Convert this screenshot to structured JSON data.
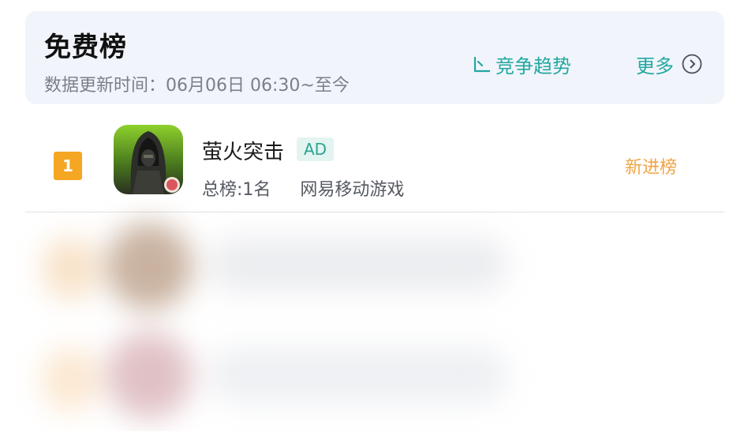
{
  "header": {
    "title": "免费榜",
    "update_time": "数据更新时间：06月06日 06:30~至今",
    "trend_label": "竞争趋势",
    "more_label": "更多"
  },
  "list": [
    {
      "rank": "1",
      "name": "萤火突击",
      "ad_tag": "AD",
      "overall_rank": "总榜:1名",
      "publisher": "网易移动游戏",
      "status": "新进榜"
    }
  ],
  "icons": {
    "trend": "trend-chart-icon",
    "more": "circle-chevron-right-icon"
  },
  "colors": {
    "accent": "#23a8a1",
    "rank_badge": "#f5a623",
    "new_tag": "#f0a445",
    "header_bg": "#f1f5fb"
  }
}
